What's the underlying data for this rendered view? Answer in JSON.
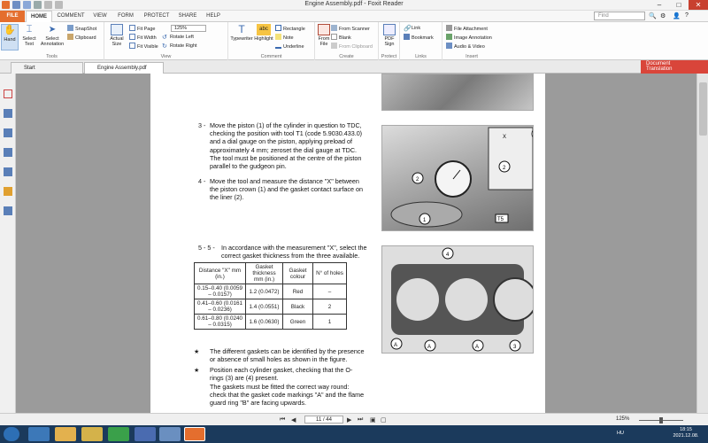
{
  "app": {
    "window_title": "Engine Assembly.pdf - Foxit Reader"
  },
  "ribbon_tabs": [
    "FILE",
    "HOME",
    "COMMENT",
    "VIEW",
    "FORM",
    "PROTECT",
    "SHARE",
    "HELP"
  ],
  "find_placeholder": "Find",
  "ribbon": {
    "tools": {
      "label": "Tools",
      "hand": "Hand",
      "select_text": "Select\nText",
      "select_annotation": "Select\nAnnotation",
      "snapshot": "SnapShot",
      "clipboard": "Clipboard"
    },
    "view": {
      "label": "View",
      "actual_size": "Actual\nSize",
      "fit_page": "Fit Page",
      "fit_width": "Fit Width",
      "fit_visible": "Fit Visible",
      "zoom": "125%",
      "rotate_left": "Rotate Left",
      "rotate_right": "Rotate Right"
    },
    "comment": {
      "label": "Comment",
      "typewriter": "Typewriter",
      "highlight": "Highlight",
      "rectangle": "Rectangle",
      "note": "Note",
      "underline": "Underline"
    },
    "create": {
      "label": "Create",
      "from_file": "From\nFile",
      "from_scanner": "From Scanner",
      "blank": "Blank",
      "from_clipboard": "From Clipboard"
    },
    "protect": {
      "label": "Protect",
      "pdf_sign": "PDF\nSign"
    },
    "links": {
      "label": "Links",
      "link": "Link",
      "bookmark": "Bookmark"
    },
    "insert": {
      "label": "Insert",
      "file_attachment": "File Attachment",
      "image_annotation": "Image Annotation",
      "audio_video": "Audio & Video"
    }
  },
  "doc_tabs": {
    "start": "Start",
    "doc": "Engine Assembly.pdf"
  },
  "doc_translation": "Document\nTranslation",
  "content": {
    "step3_num": "3 -",
    "step3": "Move the piston (1) of the cylinder in question to TDC, checking the position with tool T1 (code 5.9030.433.0) and a dial gauge on the piston, applying preload of approximately 4 mm; zeroset the dial gauge at TDC. The tool must be positioned at the centre of the piston parallel to the gudgeon pin.",
    "step4_num": "4 -",
    "step4": "Move the tool and measure the distance \"X\" between the piston crown (1) and the gasket contact surface on the liner (2).",
    "step5_num": "5 - 5 -",
    "step5": "In accordance with the measurement \"X\", select the correct gasket thickness from the three available.",
    "table_headers": [
      "Distance \"X\" mm (in.)",
      "Gasket thickness mm (in.)",
      "Gasket colour",
      "N° of holes"
    ],
    "table_rows": [
      [
        "0.15–0.40 (0.0059 – 0.0157)",
        "1.2 (0.0472)",
        "Red",
        "–"
      ],
      [
        "0.41–0.60 (0.0161 – 0.0236)",
        "1.4 (0.0551)",
        "Black",
        "2"
      ],
      [
        "0.61–0.80 (0.0240 – 0.0315)",
        "1.6 (0.0630)",
        "Green",
        "1"
      ]
    ],
    "bullet1": "The different gaskets can be identified by the presence or absence of small holes as shown in the figure.",
    "bullet2": "Position each cylinder gasket, checking that the O-rings (3) are (4) present.",
    "bullet2b": "The gaskets must be fitted the correct way round: check that the gasket code markings \"A\" and the flame guard ring \"B\" are facing upwards.",
    "img2_labels": [
      "X",
      "1",
      "2",
      "2",
      "1",
      "T5"
    ],
    "img3_labels": [
      "4",
      "A",
      "A",
      "A",
      "3"
    ]
  },
  "status": {
    "page": "11 / 44",
    "zoom": "125%"
  },
  "taskbar": {
    "lang": "HU",
    "time": "18:15",
    "date": "2021.12.08."
  }
}
